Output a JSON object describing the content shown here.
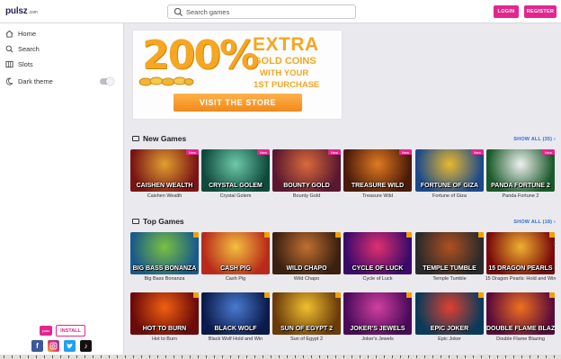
{
  "header": {
    "logo": "pulsz",
    "logo_suffix": ".com",
    "search_placeholder": "Search games",
    "login_label": "LOGIN",
    "register_label": "REGISTER"
  },
  "sidebar": {
    "items": [
      {
        "label": "Home",
        "icon": "home-icon"
      },
      {
        "label": "Search",
        "icon": "search-icon"
      },
      {
        "label": "Slots",
        "icon": "slots-icon"
      },
      {
        "label": "Dark theme",
        "icon": "moon-icon"
      }
    ],
    "dark_theme_on": false,
    "app_badge": "pulsz",
    "install_label": "INSTALL",
    "social": [
      "facebook-icon",
      "instagram-icon",
      "twitter-icon",
      "tiktok-icon"
    ]
  },
  "banner": {
    "percent": "200%",
    "extra": "EXTRA",
    "gold": "GOLD COINS",
    "with": "WITH YOUR",
    "purchase": "1ST PURCHASE",
    "cta": "VISIT THE STORE"
  },
  "new_games": {
    "title": "New Games",
    "show_all": "SHOW ALL (35)",
    "games": [
      {
        "name": "Caishen Wealth",
        "art": "CAISHEN WEALTH",
        "tag": "New",
        "colors": [
          "#7a1414",
          "#e0a030"
        ]
      },
      {
        "name": "Crystal Golem",
        "art": "CRYSTAL GOLEM",
        "tag": "New",
        "colors": [
          "#0e4a3c",
          "#6fc9a8"
        ]
      },
      {
        "name": "Bounty Gold",
        "art": "BOUNTY GOLD",
        "tag": "New",
        "colors": [
          "#5a1830",
          "#d86a3a"
        ]
      },
      {
        "name": "Treasure Wild",
        "art": "TREASURE WILD",
        "tag": "New",
        "colors": [
          "#4a1a0a",
          "#e07a20"
        ]
      },
      {
        "name": "Fortune of Giza",
        "art": "FORTUNE OF GIZA",
        "tag": "New",
        "colors": [
          "#1c4a8a",
          "#e8b830"
        ]
      },
      {
        "name": "Panda Fortune 2",
        "art": "PANDA FORTUNE 2",
        "tag": "New",
        "colors": [
          "#1a5a2a",
          "#f0f0f0"
        ]
      }
    ]
  },
  "top_games": {
    "title": "Top Games",
    "show_all": "SHOW ALL (18)",
    "games": [
      {
        "name": "Big Bass Bonanza",
        "art": "BIG BASS BONANZA",
        "colors": [
          "#1a5a8a",
          "#7ac040"
        ]
      },
      {
        "name": "Cash Pig",
        "art": "CASH PIG",
        "colors": [
          "#b82a1a",
          "#f2c040"
        ]
      },
      {
        "name": "Wild Chapo",
        "art": "WILD CHAPO",
        "colors": [
          "#3a2010",
          "#c07030"
        ]
      },
      {
        "name": "Cycle of Luck",
        "art": "CYCLE OF LUCK",
        "colors": [
          "#3a0a6a",
          "#e03070"
        ]
      },
      {
        "name": "Temple Tumble",
        "art": "TEMPLE TUMBLE",
        "colors": [
          "#2a2a2a",
          "#b05020"
        ]
      },
      {
        "name": "15 Dragon Pearls: Hold and Win",
        "art": "15 DRAGON PEARLS",
        "colors": [
          "#7a0a0a",
          "#f0b030"
        ]
      }
    ]
  },
  "third_row": {
    "games": [
      {
        "name": "Hot to Burn",
        "art": "HOT TO BURN",
        "colors": [
          "#6a0a0a",
          "#f06010"
        ]
      },
      {
        "name": "Black Wolf Hold and Win",
        "art": "BLACK WOLF",
        "colors": [
          "#0a1a4a",
          "#4a7ad0"
        ]
      },
      {
        "name": "Sun of Egypt 2",
        "art": "SUN OF EGYPT 2",
        "colors": [
          "#6a3a0a",
          "#f0c030"
        ]
      },
      {
        "name": "Joker's Jewels",
        "art": "JOKER'S JEWELS",
        "colors": [
          "#4a0a5a",
          "#d040a0"
        ]
      },
      {
        "name": "Epic Joker",
        "art": "EPIC JOKER",
        "colors": [
          "#0a3a5a",
          "#e04030"
        ]
      },
      {
        "name": "Double Flame Blazing",
        "art": "DOUBLE FLAME BLAZING",
        "colors": [
          "#5a0a3a",
          "#f07020"
        ]
      }
    ]
  }
}
